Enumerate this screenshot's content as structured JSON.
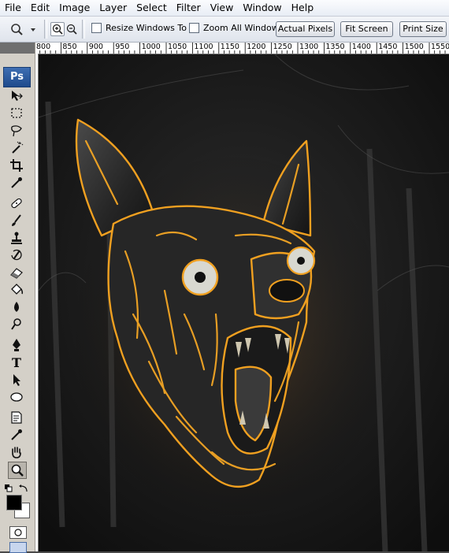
{
  "menu": [
    "File",
    "Edit",
    "Image",
    "Layer",
    "Select",
    "Filter",
    "View",
    "Window",
    "Help"
  ],
  "options": {
    "resize_windows_label": "Resize Windows To Fit",
    "zoom_all_label": "Zoom All Windows",
    "actual_pixels_label": "Actual Pixels",
    "fit_screen_label": "Fit Screen",
    "print_size_label": "Print Size"
  },
  "toolbox": {
    "logo": "Ps",
    "tools": [
      "move-tool-icon",
      "marquee-tool-icon",
      "lasso-tool-icon",
      "magic-wand-icon",
      "crop-tool-icon",
      "eyedropper-tool-icon",
      "healing-brush-icon",
      "brush-tool-icon",
      "clone-stamp-icon",
      "history-brush-icon",
      "eraser-tool-icon",
      "paint-bucket-icon",
      "blur-tool-icon",
      "dodge-tool-icon",
      "pen-tool-icon",
      "type-tool-icon",
      "path-selection-icon",
      "ellipse-tool-icon",
      "notes-tool-icon",
      "eyedropper-2-icon",
      "hand-tool-icon",
      "zoom-tool-icon"
    ],
    "type_tool_glyph": "T"
  },
  "ruler": {
    "labels": [
      "800",
      "850",
      "900",
      "950",
      "1000",
      "1050",
      "1100",
      "1150",
      "1200",
      "1250",
      "1300",
      "1350",
      "1400",
      "1450",
      "1500",
      "1550"
    ]
  },
  "colors": {
    "foreground": "#000000",
    "background": "#ffffff",
    "glow": "#f0a020"
  }
}
